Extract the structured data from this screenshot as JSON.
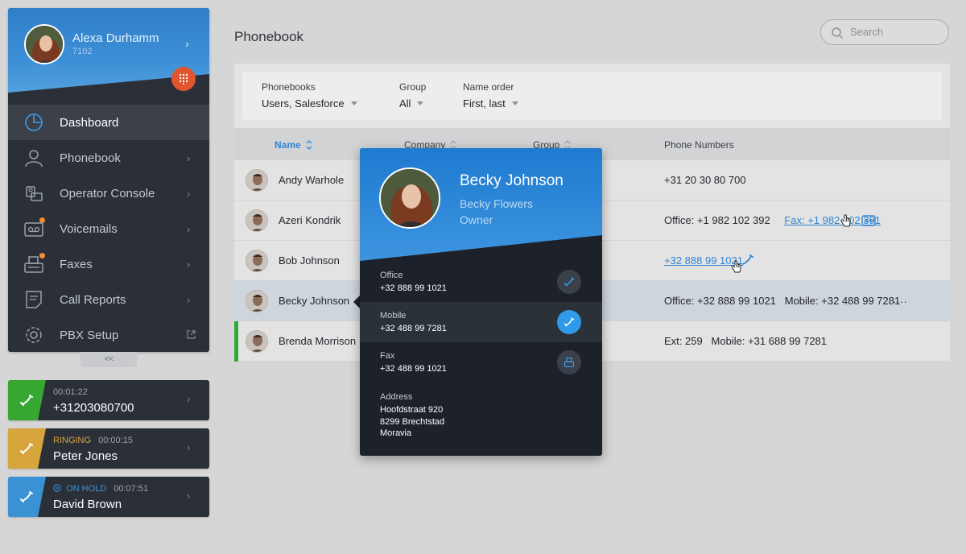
{
  "user": {
    "name": "Alexa Durhamm",
    "extension": "7102"
  },
  "colors": {
    "accent": "#2f87d6",
    "active_call": "#36a832",
    "ringing": "#d6a53b",
    "on_hold": "#3a92d4",
    "dialpad": "#e1542d",
    "badge": "#f0912b"
  },
  "sidebar": {
    "items": [
      {
        "label": "Dashboard",
        "icon": "dashboard-icon",
        "active": true
      },
      {
        "label": "Phonebook",
        "icon": "contacts-icon"
      },
      {
        "label": "Operator Console",
        "icon": "operator-console-icon"
      },
      {
        "label": "Voicemails",
        "icon": "voicemail-icon",
        "badge": true
      },
      {
        "label": "Faxes",
        "icon": "fax-icon",
        "badge": true
      },
      {
        "label": "Call Reports",
        "icon": "report-icon"
      },
      {
        "label": "PBX Setup",
        "icon": "gear-icon"
      }
    ],
    "collapse_label": "<<"
  },
  "calls": [
    {
      "status": "",
      "timer": "00:01:22",
      "title": "+31203080700"
    },
    {
      "status": "RINGING",
      "timer": "00:00:15",
      "title": "Peter Jones"
    },
    {
      "status": "ON HOLD",
      "timer": "00:07:51",
      "title": "David Brown"
    }
  ],
  "page": {
    "title": "Phonebook"
  },
  "search": {
    "placeholder": "Search"
  },
  "filters": [
    {
      "label": "Phonebooks",
      "value": "Users, Salesforce"
    },
    {
      "label": "Group",
      "value": "All"
    },
    {
      "label": "Name order",
      "value": "First, last"
    }
  ],
  "table": {
    "columns": [
      "Name",
      "Company",
      "Group",
      "Phone Numbers"
    ],
    "rows": [
      {
        "name": "Andy Warhole",
        "phones": "+31 20 30 80 700"
      },
      {
        "name": "Azeri Kondrik",
        "phones_prefix": "Office: +1 982 102 392",
        "phones_link": "Fax: +1 982 102 391"
      },
      {
        "name": "Bob Johnson",
        "phones_link": "+32 888 99 1021"
      },
      {
        "name": "Becky Johnson",
        "phones": "Office: +32 888 99 1021   Mobile: +32 488 99 7281",
        "more": "....",
        "selected": true
      },
      {
        "name": "Brenda Morrison",
        "phones": "Ext: 259   Mobile: +31 688 99 7281"
      }
    ]
  },
  "contact": {
    "name": "Becky Johnson",
    "company": "Becky Flowers",
    "role": "Owner",
    "numbers": [
      {
        "label": "Office",
        "value": "+32 888 99 1021"
      },
      {
        "label": "Mobile",
        "value": "+32 488 99 7281"
      },
      {
        "label": "Fax",
        "value": "+32 488 99 1021"
      }
    ],
    "address": {
      "label": "Address",
      "lines": [
        "Hoofdstraat 920",
        "8299 Brechtstad",
        "Moravia"
      ]
    }
  }
}
